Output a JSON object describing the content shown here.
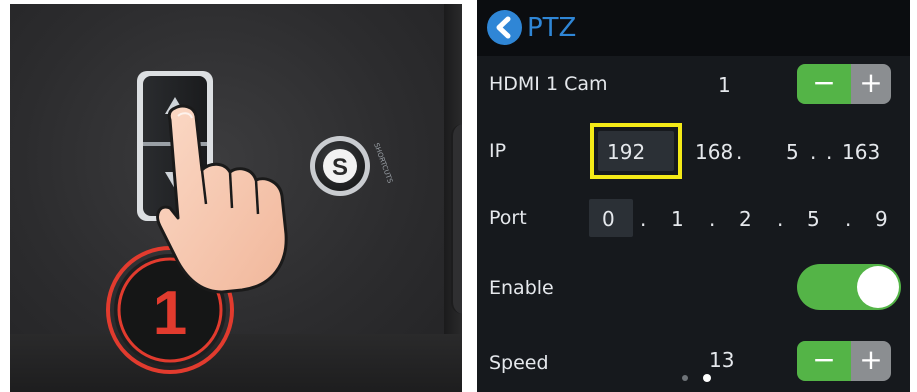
{
  "left_panel": {
    "step_number": "1",
    "s_button_letter": "S",
    "s_button_caption": "SHORTCUTS"
  },
  "ptz": {
    "title": "PTZ",
    "rows": {
      "hdmi": {
        "label": "HDMI 1 Cam",
        "value": "1"
      },
      "ip": {
        "label": "IP",
        "octet1": "192",
        "octet2": "168",
        "octet3": "5",
        "octet4": "163",
        "dot": "."
      },
      "port": {
        "label": "Port",
        "d1": "0",
        "d2": "1",
        "d3": "2",
        "d4": "5",
        "d5": "9",
        "dot": "."
      },
      "enable": {
        "label": "Enable",
        "state": "on"
      },
      "speed": {
        "label": "Speed",
        "value": "13"
      }
    },
    "stepper": {
      "minus": "−",
      "plus": "+"
    },
    "colors": {
      "accent": "#2f86d6",
      "toggle_on": "#54b447",
      "highlight": "#f4ea17",
      "background": "#16191d"
    },
    "page_dots": {
      "count": 2,
      "active": 2
    }
  }
}
